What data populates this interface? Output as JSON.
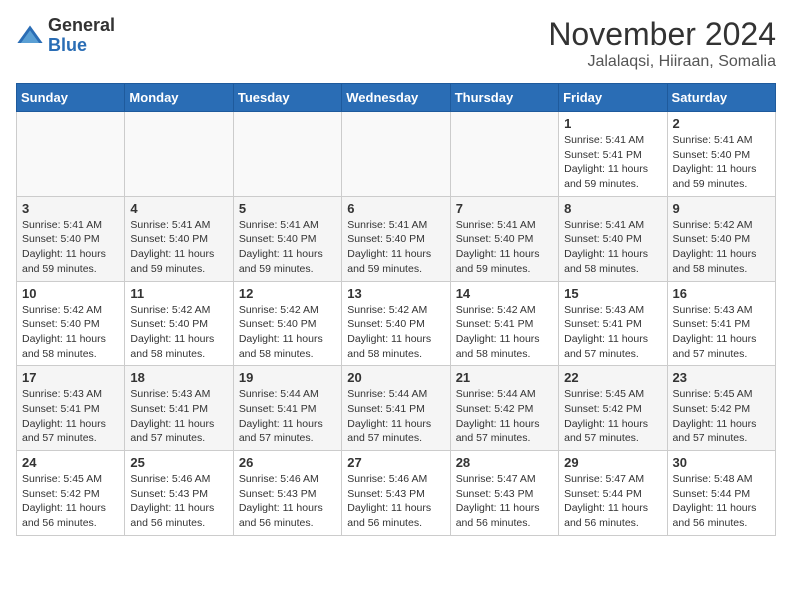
{
  "header": {
    "logo_general": "General",
    "logo_blue": "Blue",
    "month_title": "November 2024",
    "location": "Jalalaqsi, Hiiraan, Somalia"
  },
  "weekdays": [
    "Sunday",
    "Monday",
    "Tuesday",
    "Wednesday",
    "Thursday",
    "Friday",
    "Saturday"
  ],
  "weeks": [
    [
      {
        "day": "",
        "info": ""
      },
      {
        "day": "",
        "info": ""
      },
      {
        "day": "",
        "info": ""
      },
      {
        "day": "",
        "info": ""
      },
      {
        "day": "",
        "info": ""
      },
      {
        "day": "1",
        "info": "Sunrise: 5:41 AM\nSunset: 5:41 PM\nDaylight: 11 hours and 59 minutes."
      },
      {
        "day": "2",
        "info": "Sunrise: 5:41 AM\nSunset: 5:40 PM\nDaylight: 11 hours and 59 minutes."
      }
    ],
    [
      {
        "day": "3",
        "info": "Sunrise: 5:41 AM\nSunset: 5:40 PM\nDaylight: 11 hours and 59 minutes."
      },
      {
        "day": "4",
        "info": "Sunrise: 5:41 AM\nSunset: 5:40 PM\nDaylight: 11 hours and 59 minutes."
      },
      {
        "day": "5",
        "info": "Sunrise: 5:41 AM\nSunset: 5:40 PM\nDaylight: 11 hours and 59 minutes."
      },
      {
        "day": "6",
        "info": "Sunrise: 5:41 AM\nSunset: 5:40 PM\nDaylight: 11 hours and 59 minutes."
      },
      {
        "day": "7",
        "info": "Sunrise: 5:41 AM\nSunset: 5:40 PM\nDaylight: 11 hours and 59 minutes."
      },
      {
        "day": "8",
        "info": "Sunrise: 5:41 AM\nSunset: 5:40 PM\nDaylight: 11 hours and 58 minutes."
      },
      {
        "day": "9",
        "info": "Sunrise: 5:42 AM\nSunset: 5:40 PM\nDaylight: 11 hours and 58 minutes."
      }
    ],
    [
      {
        "day": "10",
        "info": "Sunrise: 5:42 AM\nSunset: 5:40 PM\nDaylight: 11 hours and 58 minutes."
      },
      {
        "day": "11",
        "info": "Sunrise: 5:42 AM\nSunset: 5:40 PM\nDaylight: 11 hours and 58 minutes."
      },
      {
        "day": "12",
        "info": "Sunrise: 5:42 AM\nSunset: 5:40 PM\nDaylight: 11 hours and 58 minutes."
      },
      {
        "day": "13",
        "info": "Sunrise: 5:42 AM\nSunset: 5:40 PM\nDaylight: 11 hours and 58 minutes."
      },
      {
        "day": "14",
        "info": "Sunrise: 5:42 AM\nSunset: 5:41 PM\nDaylight: 11 hours and 58 minutes."
      },
      {
        "day": "15",
        "info": "Sunrise: 5:43 AM\nSunset: 5:41 PM\nDaylight: 11 hours and 57 minutes."
      },
      {
        "day": "16",
        "info": "Sunrise: 5:43 AM\nSunset: 5:41 PM\nDaylight: 11 hours and 57 minutes."
      }
    ],
    [
      {
        "day": "17",
        "info": "Sunrise: 5:43 AM\nSunset: 5:41 PM\nDaylight: 11 hours and 57 minutes."
      },
      {
        "day": "18",
        "info": "Sunrise: 5:43 AM\nSunset: 5:41 PM\nDaylight: 11 hours and 57 minutes."
      },
      {
        "day": "19",
        "info": "Sunrise: 5:44 AM\nSunset: 5:41 PM\nDaylight: 11 hours and 57 minutes."
      },
      {
        "day": "20",
        "info": "Sunrise: 5:44 AM\nSunset: 5:41 PM\nDaylight: 11 hours and 57 minutes."
      },
      {
        "day": "21",
        "info": "Sunrise: 5:44 AM\nSunset: 5:42 PM\nDaylight: 11 hours and 57 minutes."
      },
      {
        "day": "22",
        "info": "Sunrise: 5:45 AM\nSunset: 5:42 PM\nDaylight: 11 hours and 57 minutes."
      },
      {
        "day": "23",
        "info": "Sunrise: 5:45 AM\nSunset: 5:42 PM\nDaylight: 11 hours and 57 minutes."
      }
    ],
    [
      {
        "day": "24",
        "info": "Sunrise: 5:45 AM\nSunset: 5:42 PM\nDaylight: 11 hours and 56 minutes."
      },
      {
        "day": "25",
        "info": "Sunrise: 5:46 AM\nSunset: 5:43 PM\nDaylight: 11 hours and 56 minutes."
      },
      {
        "day": "26",
        "info": "Sunrise: 5:46 AM\nSunset: 5:43 PM\nDaylight: 11 hours and 56 minutes."
      },
      {
        "day": "27",
        "info": "Sunrise: 5:46 AM\nSunset: 5:43 PM\nDaylight: 11 hours and 56 minutes."
      },
      {
        "day": "28",
        "info": "Sunrise: 5:47 AM\nSunset: 5:43 PM\nDaylight: 11 hours and 56 minutes."
      },
      {
        "day": "29",
        "info": "Sunrise: 5:47 AM\nSunset: 5:44 PM\nDaylight: 11 hours and 56 minutes."
      },
      {
        "day": "30",
        "info": "Sunrise: 5:48 AM\nSunset: 5:44 PM\nDaylight: 11 hours and 56 minutes."
      }
    ]
  ]
}
